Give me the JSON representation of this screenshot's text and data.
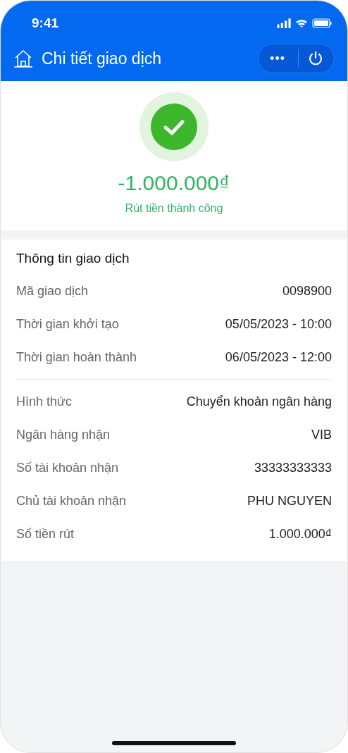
{
  "status_bar": {
    "time": "9:41"
  },
  "header": {
    "title": "Chi tiết giao dịch",
    "more": "•••"
  },
  "result": {
    "amount": "-1.000.000₫",
    "status": "Rút tiền thành công"
  },
  "details": {
    "title": "Thông tin giao dịch",
    "groups": [
      [
        {
          "label": "Mã giao dịch",
          "value": "0098900"
        },
        {
          "label": "Thời gian khởi tạo",
          "value": "05/05/2023 - 10:00"
        },
        {
          "label": "Thời gian hoàn thành",
          "value": "06/05/2023 - 12:00"
        }
      ],
      [
        {
          "label": "Hình thức",
          "value": "Chuyển khoản ngân hàng"
        },
        {
          "label": "Ngân hàng nhận",
          "value": "VIB"
        },
        {
          "label": "Số tài khoản nhận",
          "value": "33333333333"
        },
        {
          "label": "Chủ tài khoản nhận",
          "value": "PHU NGUYEN"
        },
        {
          "label": "Số tiền rút",
          "value": "1.000.000₫"
        }
      ]
    ]
  }
}
